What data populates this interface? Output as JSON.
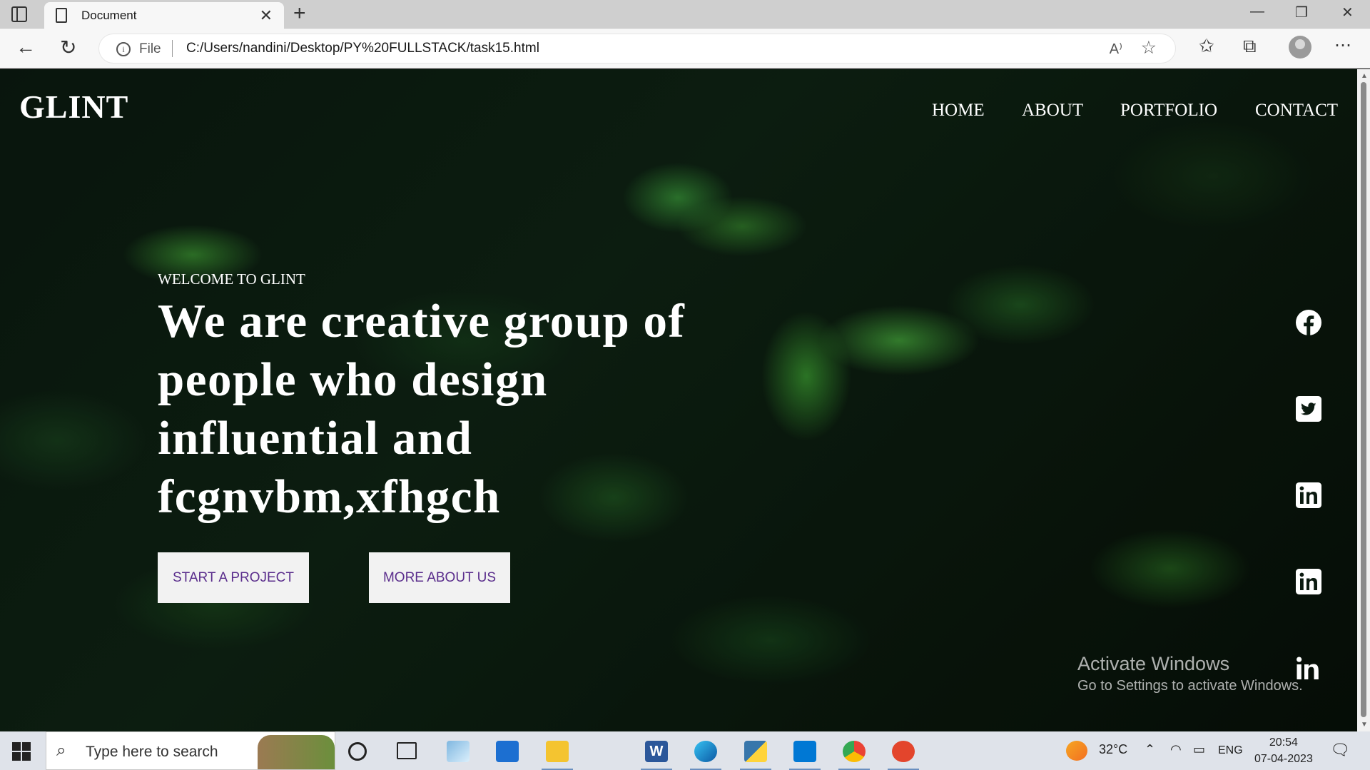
{
  "browser": {
    "tab_title": "Document",
    "tab_close": "✕",
    "new_tab": "+",
    "address_scheme": "File",
    "address_url": "C:/Users/nandini/Desktop/PY%20FULLSTACK/task15.html",
    "read_aloud": "A⁾",
    "window_controls": {
      "minimize": "—",
      "restore": "❐",
      "close": "✕"
    }
  },
  "site": {
    "logo": "GLINT",
    "nav": [
      "HOME",
      "ABOUT",
      "PORTFOLIO",
      "CONTACT"
    ],
    "welcome": "WELCOME TO GLINT",
    "headline": "We are creative group of people who design influential and fcgnvbm,xfhgch",
    "buttons": {
      "start": "START A PROJECT",
      "more": "MORE ABOUT US"
    },
    "social_icons": [
      "facebook-icon",
      "twitter-icon",
      "linkedin-icon",
      "linkedin-icon",
      "linkedin-icon"
    ]
  },
  "watermark": {
    "line1": "Activate Windows",
    "line2": "Go to Settings to activate Windows."
  },
  "taskbar": {
    "search_placeholder": "Type here to search",
    "weather": "32°C",
    "language": "ENG",
    "time": "20:54",
    "date": "07-04-2023",
    "apps": [
      "cortana-icon",
      "task-view-icon",
      "notepad-icon",
      "store-icon",
      "file-explorer-icon",
      "word-icon",
      "edge-icon",
      "python-icon",
      "vscode-icon",
      "chrome-icon",
      "app-icon"
    ]
  },
  "colors": {
    "button_text": "#5a2d8c",
    "button_bg": "#f2f2f2",
    "foliage": "#1e6b2a"
  }
}
